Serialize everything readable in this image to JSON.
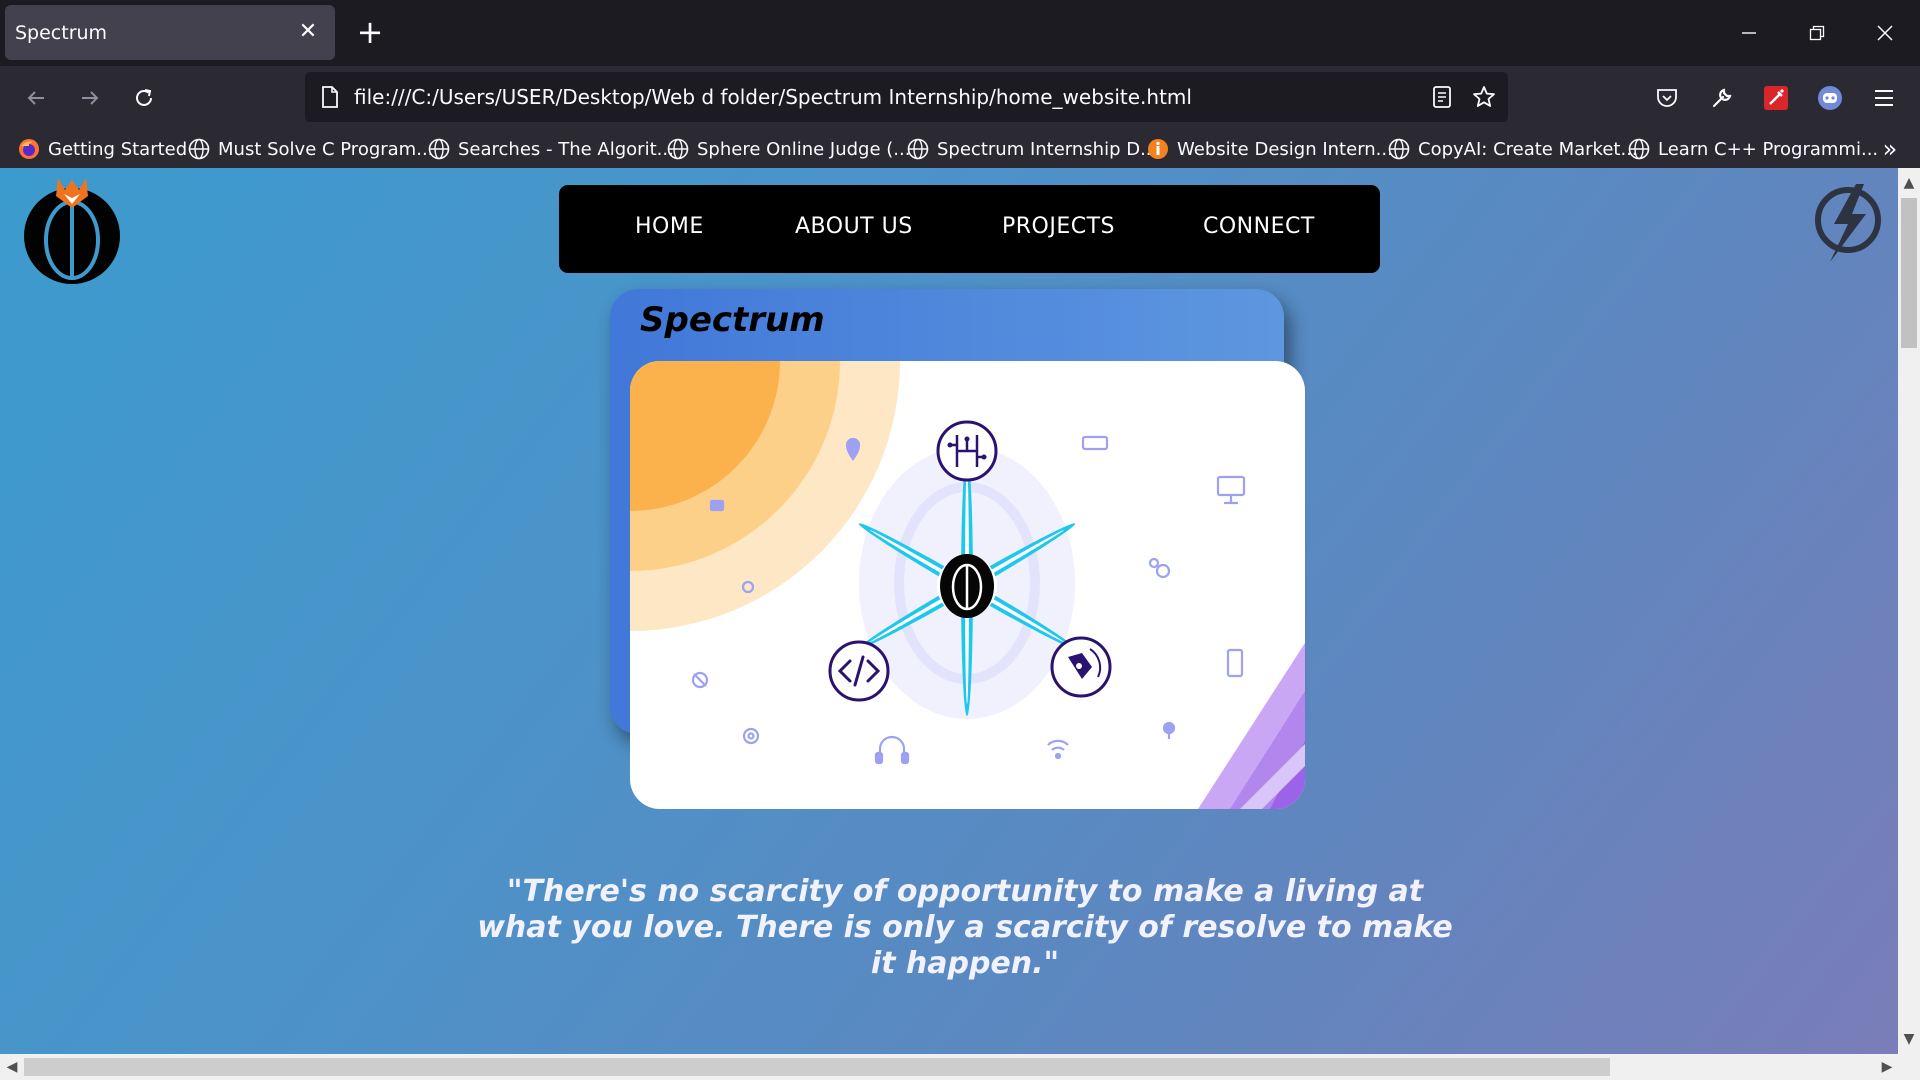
{
  "browser": {
    "tab_title": "Spectrum",
    "tab_close": "✕",
    "new_tab": "+",
    "url": "file:///C:/Users/USER/Desktop/Web d folder/Spectrum Internship/home_website.html",
    "bookmarks": [
      {
        "label": "Getting Started",
        "icon": "firefox-icon"
      },
      {
        "label": "Must Solve C Program...",
        "icon": "globe-icon"
      },
      {
        "label": "Searches - The Algorit...",
        "icon": "globe-icon"
      },
      {
        "label": "Sphere Online Judge (...",
        "icon": "globe-icon"
      },
      {
        "label": "Spectrum Internship D...",
        "icon": "globe-icon"
      },
      {
        "label": "Website Design Intern...",
        "icon": "internshala-icon"
      },
      {
        "label": "CopyAI: Create Market...",
        "icon": "globe-icon"
      },
      {
        "label": "Learn C++ Programmi...",
        "icon": "globe-icon"
      }
    ],
    "bookmarks_more": "»"
  },
  "page": {
    "nav": [
      "HOME",
      "ABOUT US",
      "PROJECTS",
      "CONNECT"
    ],
    "card_title": "Spectrum",
    "quote": "\"There's no scarcity of opportunity to make a living at what you love. There is only a scarcity of resolve to make it happen.\""
  },
  "colors": {
    "page_gradient_start": "#3c9bcd",
    "page_gradient_end": "#7a7db8",
    "hub_spokes": "#1ec8ec",
    "icon_circles": "#2b1270",
    "decor_icons": "#9ea0f4"
  }
}
